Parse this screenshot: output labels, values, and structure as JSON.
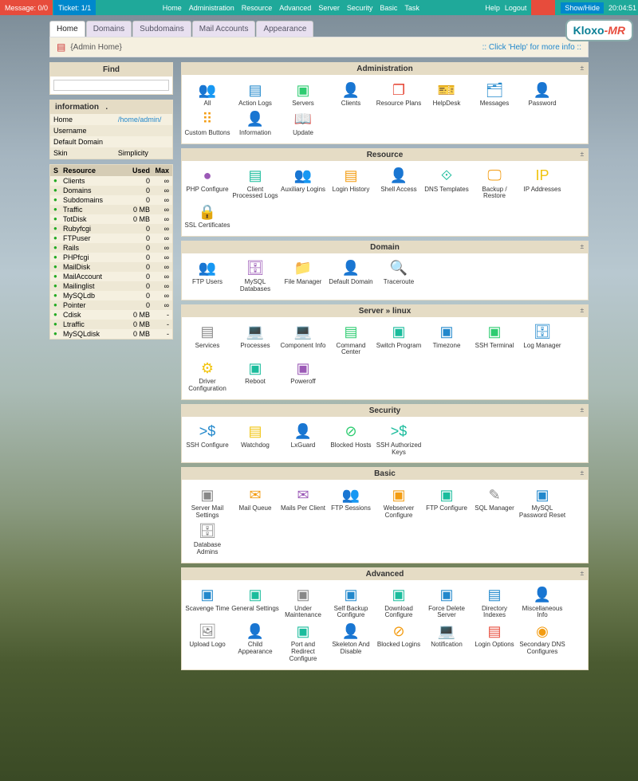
{
  "top": {
    "message": "Message: 0/0",
    "ticket": "Ticket: 1/1",
    "nav": [
      "Home",
      "Administration",
      "Resource",
      "Advanced",
      "Server",
      "Security",
      "Basic",
      "Task"
    ],
    "help": "Help",
    "logout": "Logout",
    "showhide": "Show/Hide",
    "clock": "20:04:51"
  },
  "logo": {
    "brand": "Kloxo",
    "suffix": "-MR"
  },
  "tabs": [
    "Home",
    "Domains",
    "Subdomains",
    "Mail Accounts",
    "Appearance"
  ],
  "breadcrumb": {
    "title": "{Admin Home}",
    "help": ":: Click 'Help' for more info ::"
  },
  "find": {
    "title": "Find"
  },
  "info": {
    "title": "information",
    "dot": ".",
    "rows": [
      {
        "k": "Home",
        "v": "/home/admin/",
        "link": true
      },
      {
        "k": "Username",
        "v": ""
      },
      {
        "k": "Default Domain",
        "v": ""
      },
      {
        "k": "Skin",
        "v": "Simplicity"
      }
    ]
  },
  "res": {
    "head": {
      "s": "S",
      "r": "Resource",
      "u": "Used",
      "m": "Max"
    },
    "rows": [
      {
        "n": "Clients",
        "u": "0",
        "m": "∞"
      },
      {
        "n": "Domains",
        "u": "0",
        "m": "∞"
      },
      {
        "n": "Subdomains",
        "u": "0",
        "m": "∞"
      },
      {
        "n": "Traffic",
        "u": "0 MB",
        "m": "∞"
      },
      {
        "n": "TotDisk",
        "u": "0 MB",
        "m": "∞"
      },
      {
        "n": "Rubyfcgi",
        "u": "0",
        "m": "∞"
      },
      {
        "n": "FTPuser",
        "u": "0",
        "m": "∞"
      },
      {
        "n": "Rails",
        "u": "0",
        "m": "∞"
      },
      {
        "n": "PHPfcgi",
        "u": "0",
        "m": "∞"
      },
      {
        "n": "MailDisk",
        "u": "0",
        "m": "∞"
      },
      {
        "n": "MailAccount",
        "u": "0",
        "m": "∞"
      },
      {
        "n": "Mailinglist",
        "u": "0",
        "m": "∞"
      },
      {
        "n": "MySQLdb",
        "u": "0",
        "m": "∞"
      },
      {
        "n": "Pointer",
        "u": "0",
        "m": "∞"
      },
      {
        "n": "Cdisk",
        "u": "0 MB",
        "m": "-"
      },
      {
        "n": "Ltraffic",
        "u": "0 MB",
        "m": "-"
      },
      {
        "n": "MySQLdisk",
        "u": "0 MB",
        "m": "-"
      }
    ]
  },
  "sections": [
    {
      "title": "Administration",
      "items": [
        {
          "l": "All",
          "i": "👥",
          "c": "c-orange"
        },
        {
          "l": "Action Logs",
          "i": "▤",
          "c": "c-blue"
        },
        {
          "l": "Servers",
          "i": "▣",
          "c": "c-green"
        },
        {
          "l": "Clients",
          "i": "👤",
          "c": "c-purple"
        },
        {
          "l": "Resource Plans",
          "i": "❐",
          "c": "c-red"
        },
        {
          "l": "HelpDesk",
          "i": "🎫",
          "c": "c-teal"
        },
        {
          "l": "Messages",
          "i": "🗂",
          "c": "c-blue"
        },
        {
          "l": "Password",
          "i": "👤",
          "c": "c-purple"
        },
        {
          "l": "Custom Buttons",
          "i": "⠿",
          "c": "c-orange"
        },
        {
          "l": "Information",
          "i": "👤",
          "c": "c-yellow"
        },
        {
          "l": "Update",
          "i": "📖",
          "c": "c-gray"
        }
      ]
    },
    {
      "title": "Resource",
      "items": [
        {
          "l": "PHP Configure",
          "i": "●",
          "c": "c-purple"
        },
        {
          "l": "Client Processed Logs",
          "i": "▤",
          "c": "c-teal"
        },
        {
          "l": "Auxiliary Logins",
          "i": "👥",
          "c": "c-blue"
        },
        {
          "l": "Login History",
          "i": "▤",
          "c": "c-orange"
        },
        {
          "l": "Shell Access",
          "i": "👤",
          "c": "c-red"
        },
        {
          "l": "DNS Templates",
          "i": "⟐",
          "c": "c-teal"
        },
        {
          "l": "Backup / Restore",
          "i": "🖵",
          "c": "c-orange"
        },
        {
          "l": "IP Addresses",
          "i": "IP",
          "c": "c-yellow"
        },
        {
          "l": "SSL Certificates",
          "i": "🔒",
          "c": "c-blue"
        }
      ]
    },
    {
      "title": "Domain",
      "items": [
        {
          "l": "FTP Users",
          "i": "👥",
          "c": "c-orange"
        },
        {
          "l": "MySQL Databases",
          "i": "🗄",
          "c": "c-purple"
        },
        {
          "l": "File Manager",
          "i": "📁",
          "c": "c-yellow"
        },
        {
          "l": "Default Domain",
          "i": "👤",
          "c": "c-blue"
        },
        {
          "l": "Traceroute",
          "i": "🔍",
          "c": "c-red"
        }
      ]
    },
    {
      "title": "Server » linux",
      "items": [
        {
          "l": "Services",
          "i": "▤",
          "c": "c-gray"
        },
        {
          "l": "Processes",
          "i": "💻",
          "c": "c-yellow"
        },
        {
          "l": "Component Info",
          "i": "💻",
          "c": "c-purple"
        },
        {
          "l": "Command Center",
          "i": "▤",
          "c": "c-green"
        },
        {
          "l": "Switch Program",
          "i": "▣",
          "c": "c-teal"
        },
        {
          "l": "Timezone",
          "i": "▣",
          "c": "c-blue"
        },
        {
          "l": "SSH Terminal",
          "i": "▣",
          "c": "c-green"
        },
        {
          "l": "Log Manager",
          "i": "🗄",
          "c": "c-blue"
        },
        {
          "l": "Driver Configuration",
          "i": "⚙",
          "c": "c-yellow"
        },
        {
          "l": "Reboot",
          "i": "▣",
          "c": "c-teal"
        },
        {
          "l": "Poweroff",
          "i": "▣",
          "c": "c-purple"
        }
      ]
    },
    {
      "title": "Security",
      "items": [
        {
          "l": "SSH Configure",
          "i": ">$",
          "c": "c-blue"
        },
        {
          "l": "Watchdog",
          "i": "▤",
          "c": "c-yellow"
        },
        {
          "l": "LxGuard",
          "i": "👤",
          "c": "c-purple"
        },
        {
          "l": "Blocked Hosts",
          "i": "⊘",
          "c": "c-green"
        },
        {
          "l": "SSH Authorized Keys",
          "i": ">$",
          "c": "c-teal"
        }
      ]
    },
    {
      "title": "Basic",
      "items": [
        {
          "l": "Server Mail Settings",
          "i": "▣",
          "c": "c-gray"
        },
        {
          "l": "Mail Queue",
          "i": "✉",
          "c": "c-orange"
        },
        {
          "l": "Mails Per Client",
          "i": "✉",
          "c": "c-purple"
        },
        {
          "l": "FTP Sessions",
          "i": "👥",
          "c": "c-red"
        },
        {
          "l": "Webserver Configure",
          "i": "▣",
          "c": "c-orange"
        },
        {
          "l": "FTP Configure",
          "i": "▣",
          "c": "c-teal"
        },
        {
          "l": "SQL Manager",
          "i": "✎",
          "c": "c-gray"
        },
        {
          "l": "MySQL Password Reset",
          "i": "▣",
          "c": "c-blue"
        },
        {
          "l": "Database Admins",
          "i": "🗄",
          "c": "c-gray"
        }
      ]
    },
    {
      "title": "Advanced",
      "items": [
        {
          "l": "Scavenge Time",
          "i": "▣",
          "c": "c-blue"
        },
        {
          "l": "General Settings",
          "i": "▣",
          "c": "c-teal"
        },
        {
          "l": "Under Maintenance",
          "i": "▣",
          "c": "c-gray"
        },
        {
          "l": "Self Backup Configure",
          "i": "▣",
          "c": "c-blue"
        },
        {
          "l": "Download Configure",
          "i": "▣",
          "c": "c-teal"
        },
        {
          "l": "Force Delete Server",
          "i": "▣",
          "c": "c-blue"
        },
        {
          "l": "Directory Indexes",
          "i": "▤",
          "c": "c-blue"
        },
        {
          "l": "Miscellaneous Info",
          "i": "👤",
          "c": "c-purple"
        },
        {
          "l": "Upload Logo",
          "i": "🖼",
          "c": "c-gray"
        },
        {
          "l": "Child Appearance",
          "i": "👤",
          "c": "c-orange"
        },
        {
          "l": "Port and Redirect Configure",
          "i": "▣",
          "c": "c-teal"
        },
        {
          "l": "Skeleton And Disable",
          "i": "👤",
          "c": "c-gray"
        },
        {
          "l": "Blocked Logins",
          "i": "⊘",
          "c": "c-orange"
        },
        {
          "l": "Notification",
          "i": "💻",
          "c": "c-teal"
        },
        {
          "l": "Login Options",
          "i": "▤",
          "c": "c-red"
        },
        {
          "l": "Secondary DNS Configures",
          "i": "◉",
          "c": "c-orange"
        }
      ]
    }
  ]
}
